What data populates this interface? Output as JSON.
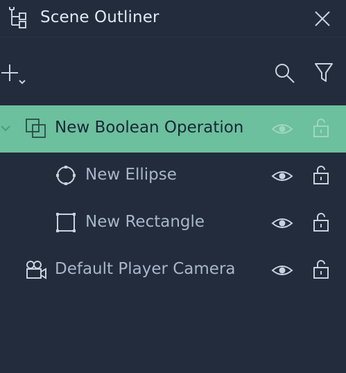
{
  "panel": {
    "title": "Scene Outliner"
  },
  "toolbar": {
    "add_icon": "add-plus-icon",
    "search_icon": "search-icon",
    "filter_icon": "filter-icon"
  },
  "outliner": {
    "items": [
      {
        "label": "New Boolean Operation",
        "icon": "boolean-operation-icon",
        "selected": true,
        "expanded": true
      },
      {
        "label": "New Ellipse",
        "icon": "ellipse-icon",
        "selected": false
      },
      {
        "label": "New Rectangle",
        "icon": "rectangle-icon",
        "selected": false
      },
      {
        "label": "Default Player Camera",
        "icon": "camera-icon",
        "selected": false
      }
    ]
  },
  "colors": {
    "background": "#222c3c",
    "selected_row": "#6cc09d",
    "text": "#a9b6c8",
    "title_text": "#e2e8f0"
  }
}
